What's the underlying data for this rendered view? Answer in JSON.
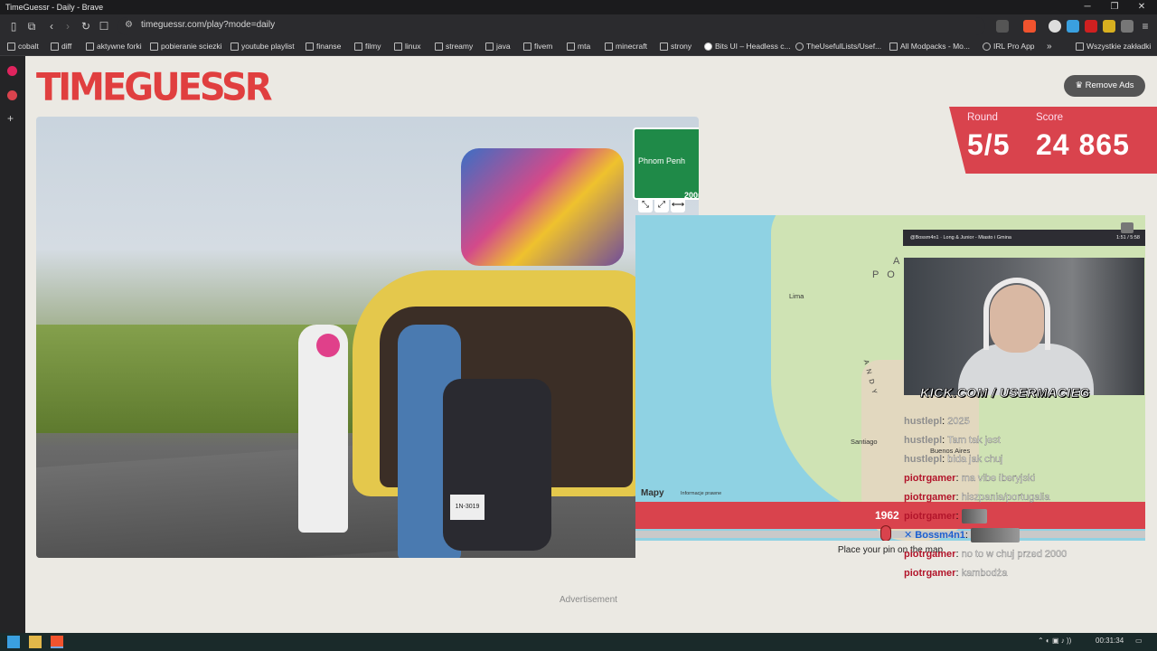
{
  "window": {
    "title": "TimeGuessr - Daily - Brave",
    "minimize": "─",
    "maximize": "❐",
    "close": "✕"
  },
  "toolbar": {
    "url": "timeguessr.com/play?mode=daily"
  },
  "bookmarks": [
    "cobalt",
    "diff",
    "aktywne forki",
    "pobieranie sciezki",
    "youtube playlist",
    "finanse",
    "filmy",
    "linux",
    "streamy",
    "java",
    "fivem",
    "mta",
    "minecraft",
    "strony",
    "Bits UI – Headless c...",
    "TheUsefulLists/Usef...",
    "All Modpacks - Mo...",
    "IRL Pro App"
  ],
  "bookmarks_overflow": "»",
  "bookmarks_all": "Wszystkie zakładki",
  "site": {
    "logo": "TIMEGUESSR",
    "remove_ads": "Remove Ads",
    "photo_sign": "Phnom Penh",
    "photo_sign_dist": "200m",
    "photo_plate": "1N-3019",
    "round_label": "Round",
    "round_value": "5/5",
    "score_label": "Score",
    "score_value": "24 865",
    "map_labels": {
      "lima": "Lima",
      "santiago": "Santiago",
      "buenos_aires": "Buenos Aires",
      "andy": "A N D Y",
      "region": "A",
      "region2": "P O"
    },
    "map_brand": "Mapy",
    "map_legal": "Informacje prawne",
    "year": "1962",
    "place_pin": "Place your pin on the map",
    "advertisement": "Advertisement"
  },
  "stream": {
    "now_playing": "@Bossm4n1 · Long & Junior - Miasto i Gmina",
    "time": "1:51 / 5:58",
    "overlay": "KICK.COM / USERMACIEG",
    "chat": [
      {
        "user": "hustlepl",
        "msg": "2025",
        "color": "#8e8e8e"
      },
      {
        "user": "hustlepl",
        "msg": "Tam tak jest",
        "color": "#8e8e8e"
      },
      {
        "user": "hustlepl",
        "msg": "bida jak chuj",
        "color": "#8e8e8e"
      },
      {
        "user": "piotrgamer",
        "msg": "ma vibe iberyjski",
        "color": "#b2152b"
      },
      {
        "user": "piotrgamer",
        "msg": "hiszpania/portugalia",
        "color": "#b2152b"
      },
      {
        "user": "piotrgamer",
        "msg": "",
        "color": "#b2152b"
      },
      {
        "user": "Bossm4n1",
        "msg": "",
        "color": "#1a5fd0"
      },
      {
        "user": "piotrgamer",
        "msg": "no to w chuj przed 2000",
        "color": "#b2152b"
      },
      {
        "user": "piotrgamer",
        "msg": "kambodża",
        "color": "#b2152b"
      }
    ]
  },
  "taskbar": {
    "time": "00:31:34"
  },
  "colors": {
    "accent": "#d9434d",
    "page_bg": "#ebe9e3"
  }
}
